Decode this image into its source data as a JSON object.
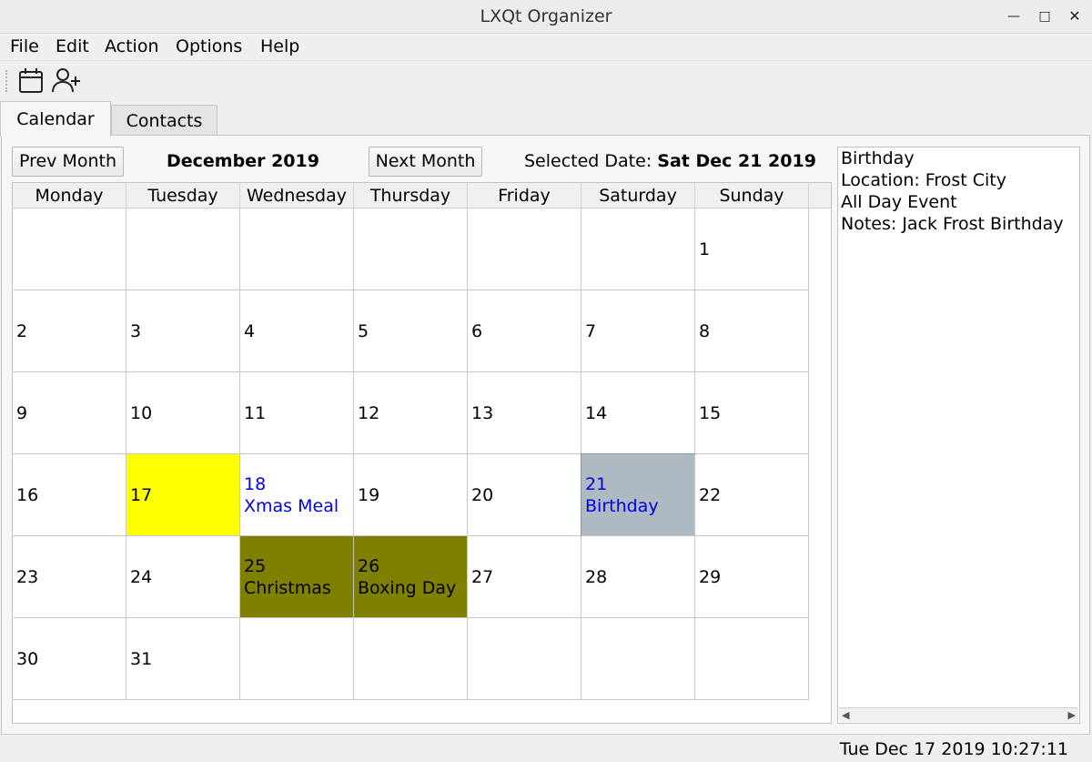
{
  "window": {
    "title": "LXQt Organizer"
  },
  "menubar": {
    "items": [
      "File",
      "Edit",
      "Action",
      "Options",
      "Help"
    ]
  },
  "toolbar": {
    "icons": [
      "calendar-icon",
      "add-contact-icon"
    ]
  },
  "tabs": [
    {
      "label": "Calendar",
      "active": true
    },
    {
      "label": "Contacts",
      "active": false
    }
  ],
  "calendar": {
    "prev_label": "Prev Month",
    "next_label": "Next Month",
    "month_label": "December 2019",
    "selected_prefix": "Selected Date:",
    "selected_date": "Sat Dec 21 2019",
    "weekdays": [
      "Monday",
      "Tuesday",
      "Wednesday",
      "Thursday",
      "Friday",
      "Saturday",
      "Sunday"
    ],
    "weeks": [
      [
        {
          "day": ""
        },
        {
          "day": ""
        },
        {
          "day": ""
        },
        {
          "day": ""
        },
        {
          "day": ""
        },
        {
          "day": ""
        },
        {
          "day": "1"
        }
      ],
      [
        {
          "day": "2"
        },
        {
          "day": "3"
        },
        {
          "day": "4"
        },
        {
          "day": "5"
        },
        {
          "day": "6"
        },
        {
          "day": "7"
        },
        {
          "day": "8"
        }
      ],
      [
        {
          "day": "9"
        },
        {
          "day": "10"
        },
        {
          "day": "11"
        },
        {
          "day": "12"
        },
        {
          "day": "13"
        },
        {
          "day": "14"
        },
        {
          "day": "15"
        }
      ],
      [
        {
          "day": "16"
        },
        {
          "day": "17",
          "bg": "#ffff00"
        },
        {
          "day": "18",
          "event": "Xmas Meal",
          "color": "#0000ee"
        },
        {
          "day": "19"
        },
        {
          "day": "20"
        },
        {
          "day": "21",
          "event": "Birthday",
          "color": "#0000ee",
          "bg": "#aeb9c2",
          "selected": true
        },
        {
          "day": "22"
        }
      ],
      [
        {
          "day": "23"
        },
        {
          "day": "24"
        },
        {
          "day": "25",
          "event": "Christmas",
          "bg": "#808000"
        },
        {
          "day": "26",
          "event": "Boxing Day",
          "bg": "#808000"
        },
        {
          "day": "27"
        },
        {
          "day": "28"
        },
        {
          "day": "29"
        }
      ],
      [
        {
          "day": "30"
        },
        {
          "day": "31"
        },
        {
          "day": ""
        },
        {
          "day": ""
        },
        {
          "day": ""
        },
        {
          "day": ""
        },
        {
          "day": ""
        }
      ]
    ]
  },
  "details": {
    "lines": [
      "Birthday",
      "Location: Frost City",
      "All Day Event",
      "Notes: Jack Frost Birthday"
    ]
  },
  "status": {
    "datetime": "Tue Dec 17 2019 10:27:11"
  }
}
